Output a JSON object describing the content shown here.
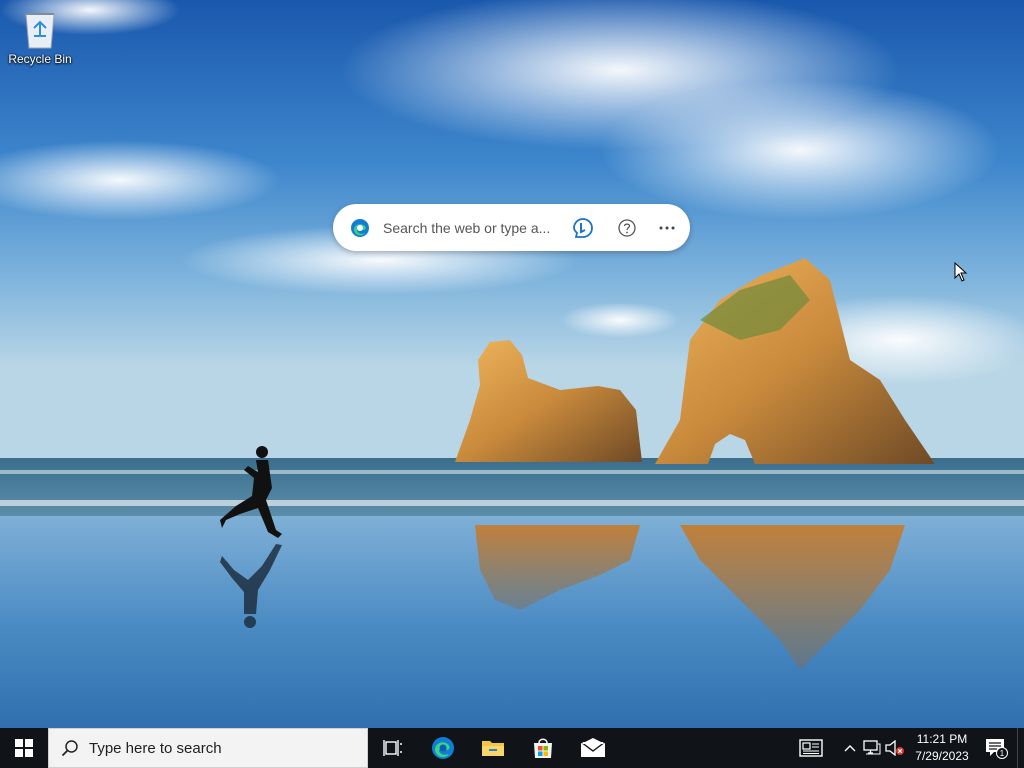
{
  "desktop": {
    "icons": [
      {
        "label": "Recycle Bin",
        "icon": "recycle-bin-icon"
      }
    ]
  },
  "edge_search": {
    "placeholder": "Search the web or type a...",
    "icons": [
      "edge-logo-icon",
      "bing-chat-icon",
      "help-icon",
      "more-options-icon"
    ]
  },
  "taskbar": {
    "start_icon": "windows-logo-icon",
    "search_placeholder": "Type here to search",
    "apps": [
      {
        "name": "Task View",
        "icon": "task-view-icon"
      },
      {
        "name": "Microsoft Edge",
        "icon": "edge-icon"
      },
      {
        "name": "File Explorer",
        "icon": "folder-icon"
      },
      {
        "name": "Microsoft Store",
        "icon": "store-icon"
      },
      {
        "name": "Mail",
        "icon": "mail-icon"
      }
    ],
    "tray": {
      "icons": [
        "news-widget-icon",
        "chevron-up-icon",
        "network-icon",
        "volume-muted-icon"
      ],
      "time": "11:21 PM",
      "date": "7/29/2023",
      "notification_count": "1"
    }
  },
  "colors": {
    "taskbar_bg": "#101418",
    "search_box_bg": "#f3f3f3",
    "sky_top": "#1f5fb0",
    "accent_edge": "#0f7fd6"
  }
}
